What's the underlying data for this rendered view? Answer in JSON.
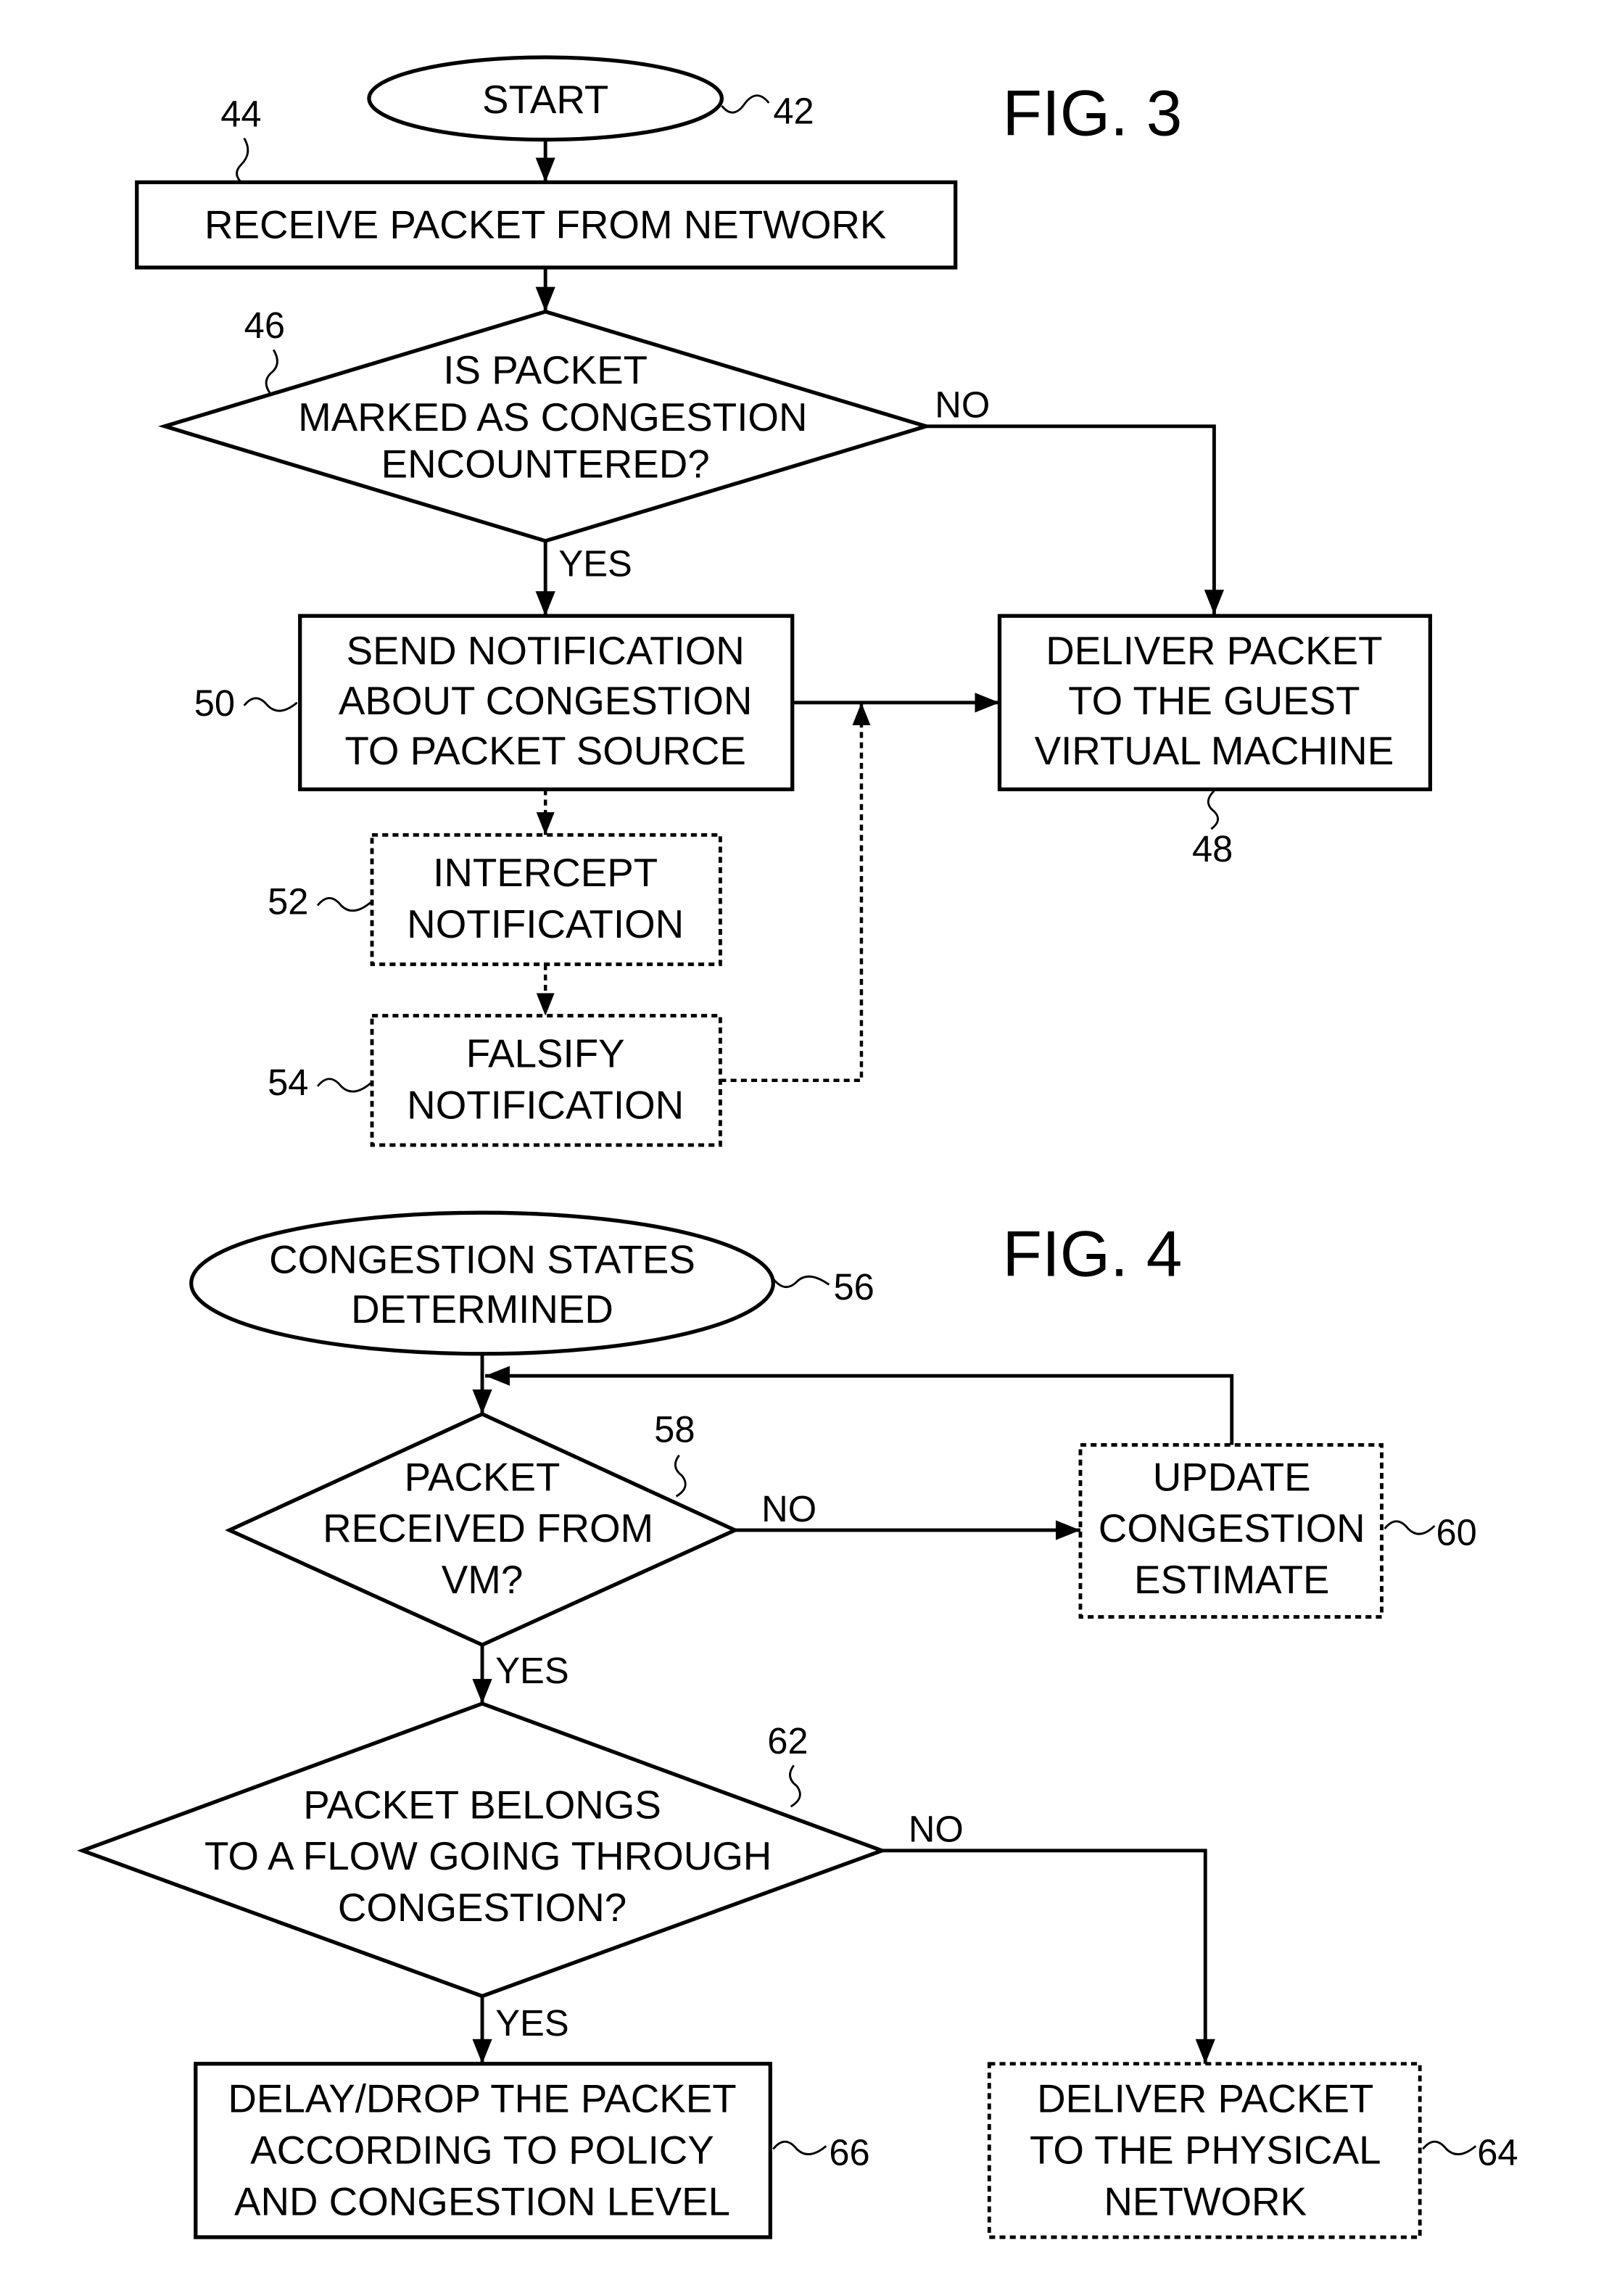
{
  "fig3": {
    "title": "FIG. 3",
    "start": {
      "label": "START",
      "ref": "42"
    },
    "receive": {
      "label": "RECEIVE PACKET FROM NETWORK",
      "ref": "44"
    },
    "decision": {
      "lines": [
        "IS PACKET",
        "MARKED AS CONGESTION",
        "ENCOUNTERED?"
      ],
      "ref": "46",
      "no_label": "NO",
      "yes_label": "YES"
    },
    "send_notification": {
      "lines": [
        "SEND NOTIFICATION",
        "ABOUT CONGESTION",
        "TO PACKET SOURCE"
      ],
      "ref": "50"
    },
    "deliver_guest": {
      "lines": [
        "DELIVER PACKET",
        "TO THE GUEST",
        "VIRTUAL MACHINE"
      ],
      "ref": "48"
    },
    "intercept": {
      "lines": [
        "INTERCEPT",
        "NOTIFICATION"
      ],
      "ref": "52"
    },
    "falsify": {
      "lines": [
        "FALSIFY",
        "NOTIFICATION"
      ],
      "ref": "54"
    }
  },
  "fig4": {
    "title": "FIG. 4",
    "start": {
      "lines": [
        "CONGESTION STATES",
        "DETERMINED"
      ],
      "ref": "56"
    },
    "decision1": {
      "lines": [
        "PACKET",
        "RECEIVED FROM",
        "VM?"
      ],
      "ref": "58",
      "no_label": "NO",
      "yes_label": "YES"
    },
    "update": {
      "lines": [
        "UPDATE",
        "CONGESTION",
        "ESTIMATE"
      ],
      "ref": "60"
    },
    "decision2": {
      "lines": [
        "PACKET  BELONGS",
        "TO A FLOW GOING THROUGH",
        "CONGESTION?"
      ],
      "ref": "62",
      "no_label": "NO",
      "yes_label": "YES"
    },
    "delay_drop": {
      "lines": [
        "DELAY/DROP THE PACKET",
        "ACCORDING TO POLICY",
        "AND CONGESTION LEVEL"
      ],
      "ref": "66"
    },
    "deliver_physical": {
      "lines": [
        "DELIVER PACKET",
        "TO THE PHYSICAL",
        "NETWORK"
      ],
      "ref": "64"
    }
  }
}
